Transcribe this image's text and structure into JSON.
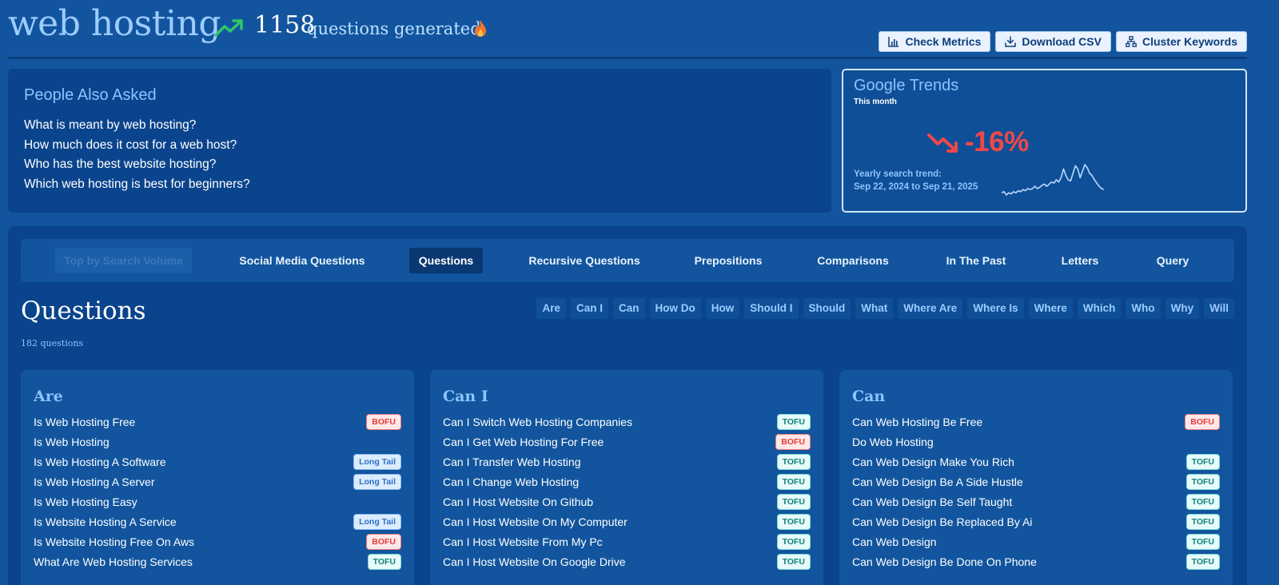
{
  "header": {
    "title": "web hosting",
    "generated_count": "1158",
    "generated_label": "questions generated",
    "buttons": {
      "check_metrics": "Check Metrics",
      "download_csv": "Download CSV",
      "cluster_keywords": "Cluster Keywords"
    }
  },
  "paa": {
    "title": "People Also Asked",
    "questions": [
      "What is meant by web hosting?",
      "How much does it cost for a web host?",
      "Who has the best website hosting?",
      "Which web hosting is best for beginners?"
    ]
  },
  "trends": {
    "title": "Google Trends",
    "period": "This month",
    "change": "-16%",
    "yearly_label": "Yearly search trend:",
    "yearly_range": "Sep 22, 2024 to Sep 21, 2025",
    "sparkline": [
      8,
      9,
      6,
      8,
      7,
      9,
      8,
      10,
      9,
      11,
      10,
      12,
      11,
      12,
      14,
      12,
      13,
      15,
      16,
      14,
      16,
      18,
      17,
      20,
      18,
      22,
      30,
      24,
      20,
      19,
      26,
      33,
      30,
      22,
      28,
      34,
      31,
      26,
      24,
      20,
      17,
      14,
      12,
      11
    ],
    "down_color": "#f04848"
  },
  "tabs": [
    {
      "label": "Top by Search Volume",
      "state": "disabled"
    },
    {
      "label": "Social Media Questions",
      "state": "normal"
    },
    {
      "label": "Questions",
      "state": "active"
    },
    {
      "label": "Recursive Questions",
      "state": "normal"
    },
    {
      "label": "Prepositions",
      "state": "normal"
    },
    {
      "label": "Comparisons",
      "state": "normal"
    },
    {
      "label": "In The Past",
      "state": "normal"
    },
    {
      "label": "Letters",
      "state": "normal"
    },
    {
      "label": "Query",
      "state": "normal"
    }
  ],
  "section": {
    "title": "Questions",
    "count": "182 questions",
    "filters": [
      "Are",
      "Can I",
      "Can",
      "How Do",
      "How",
      "Should I",
      "Should",
      "What",
      "Where Are",
      "Where Is",
      "Where",
      "Which",
      "Who",
      "Why",
      "Will"
    ]
  },
  "columns": [
    {
      "title": "Are",
      "rows": [
        {
          "text": "Is Web Hosting Free",
          "badge": "BOFU"
        },
        {
          "text": "Is Web Hosting",
          "badge": ""
        },
        {
          "text": "Is Web Hosting A Software",
          "badge": "Long Tail"
        },
        {
          "text": "Is Web Hosting A Server",
          "badge": "Long Tail"
        },
        {
          "text": "Is Web Hosting Easy",
          "badge": ""
        },
        {
          "text": "Is Website Hosting A Service",
          "badge": "Long Tail"
        },
        {
          "text": "Is Website Hosting Free On Aws",
          "badge": "BOFU"
        },
        {
          "text": "What Are Web Hosting Services",
          "badge": "TOFU"
        }
      ]
    },
    {
      "title": "Can I",
      "rows": [
        {
          "text": "Can I Switch Web Hosting Companies",
          "badge": "TOFU"
        },
        {
          "text": "Can I Get Web Hosting For Free",
          "badge": "BOFU"
        },
        {
          "text": "Can I Transfer Web Hosting",
          "badge": "TOFU"
        },
        {
          "text": "Can I Change Web Hosting",
          "badge": "TOFU"
        },
        {
          "text": "Can I Host Website On Github",
          "badge": "TOFU"
        },
        {
          "text": "Can I Host Website On My Computer",
          "badge": "TOFU"
        },
        {
          "text": "Can I Host Website From My Pc",
          "badge": "TOFU"
        },
        {
          "text": "Can I Host Website On Google Drive",
          "badge": "TOFU"
        }
      ]
    },
    {
      "title": "Can",
      "rows": [
        {
          "text": "Can Web Hosting Be Free",
          "badge": "BOFU"
        },
        {
          "text": "Do Web Hosting",
          "badge": ""
        },
        {
          "text": "Can Web Design Make You Rich",
          "badge": "TOFU"
        },
        {
          "text": "Can Web Design Be A Side Hustle",
          "badge": "TOFU"
        },
        {
          "text": "Can Web Design Be Self Taught",
          "badge": "TOFU"
        },
        {
          "text": "Can Web Design Be Replaced By Ai",
          "badge": "TOFU"
        },
        {
          "text": "Can Web Design",
          "badge": "TOFU"
        },
        {
          "text": "Can Web Design Be Done On Phone",
          "badge": "TOFU"
        }
      ]
    }
  ]
}
